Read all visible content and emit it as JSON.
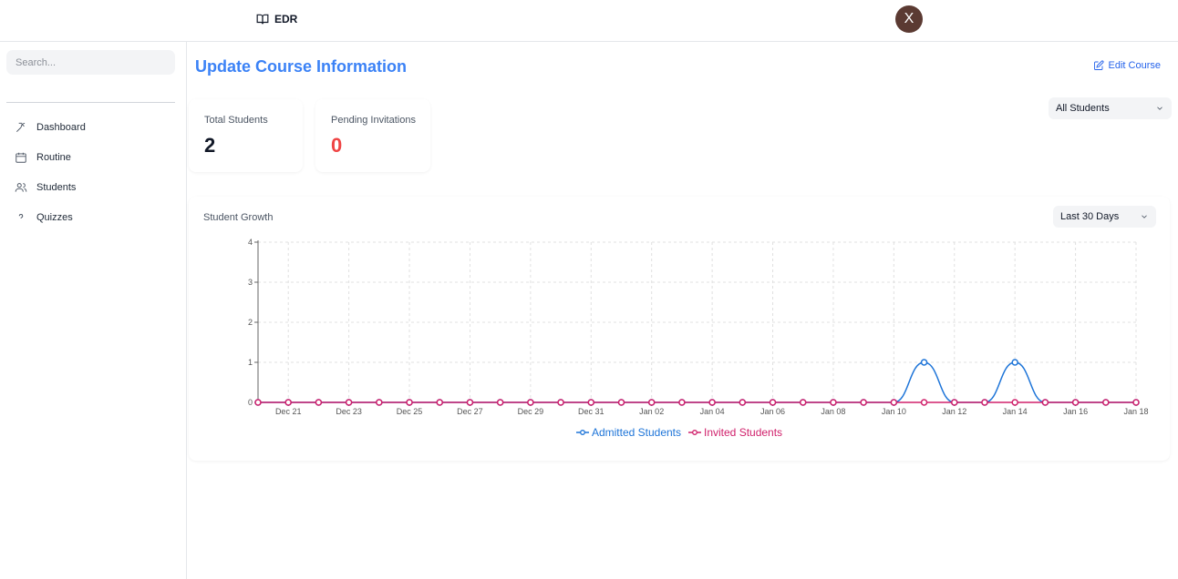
{
  "header": {
    "brand": "EDR",
    "avatar_initial": "X"
  },
  "sidebar": {
    "search_placeholder": "Search...",
    "items": [
      {
        "label": "Dashboard",
        "icon": "dashboard-icon"
      },
      {
        "label": "Routine",
        "icon": "calendar-icon"
      },
      {
        "label": "Students",
        "icon": "users-icon"
      },
      {
        "label": "Quizzes",
        "icon": "question-icon"
      }
    ]
  },
  "main": {
    "title": "Update Course Information",
    "edit_label": "Edit Course",
    "filter_select": "All Students",
    "stats": [
      {
        "label": "Total Students",
        "value": "2",
        "color": "#111827"
      },
      {
        "label": "Pending Invitations",
        "value": "0",
        "color": "#ef4444"
      }
    ],
    "chart_card": {
      "title": "Student Growth",
      "range_select": "Last 30 Days"
    }
  },
  "chart_data": {
    "type": "line",
    "title": "Student Growth",
    "x": [
      "Dec 20",
      "Dec 21",
      "Dec 22",
      "Dec 23",
      "Dec 24",
      "Dec 25",
      "Dec 26",
      "Dec 27",
      "Dec 28",
      "Dec 29",
      "Dec 30",
      "Dec 31",
      "Jan 01",
      "Jan 02",
      "Jan 03",
      "Jan 04",
      "Jan 05",
      "Jan 06",
      "Jan 07",
      "Jan 08",
      "Jan 09",
      "Jan 10",
      "Jan 11",
      "Jan 12",
      "Jan 13",
      "Jan 14",
      "Jan 15",
      "Jan 16",
      "Jan 17",
      "Jan 18"
    ],
    "x_tick_labels": [
      "Dec 21",
      "Dec 23",
      "Dec 25",
      "Dec 27",
      "Dec 29",
      "Dec 31",
      "Jan 02",
      "Jan 04",
      "Jan 06",
      "Jan 08",
      "Jan 10",
      "Jan 12",
      "Jan 14",
      "Jan 16",
      "Jan 18"
    ],
    "y_ticks": [
      0,
      1,
      2,
      3,
      4
    ],
    "ylim": [
      0,
      4
    ],
    "grid": true,
    "legend_position": "bottom-center",
    "series": [
      {
        "name": "Admitted Students",
        "color": "#1d74d8",
        "values": [
          0,
          0,
          0,
          0,
          0,
          0,
          0,
          0,
          0,
          0,
          0,
          0,
          0,
          0,
          0,
          0,
          0,
          0,
          0,
          0,
          0,
          0,
          1,
          0,
          0,
          1,
          0,
          0,
          0,
          0
        ]
      },
      {
        "name": "Invited Students",
        "color": "#d0206b",
        "values": [
          0,
          0,
          0,
          0,
          0,
          0,
          0,
          0,
          0,
          0,
          0,
          0,
          0,
          0,
          0,
          0,
          0,
          0,
          0,
          0,
          0,
          0,
          0,
          0,
          0,
          0,
          0,
          0,
          0,
          0
        ]
      }
    ]
  }
}
